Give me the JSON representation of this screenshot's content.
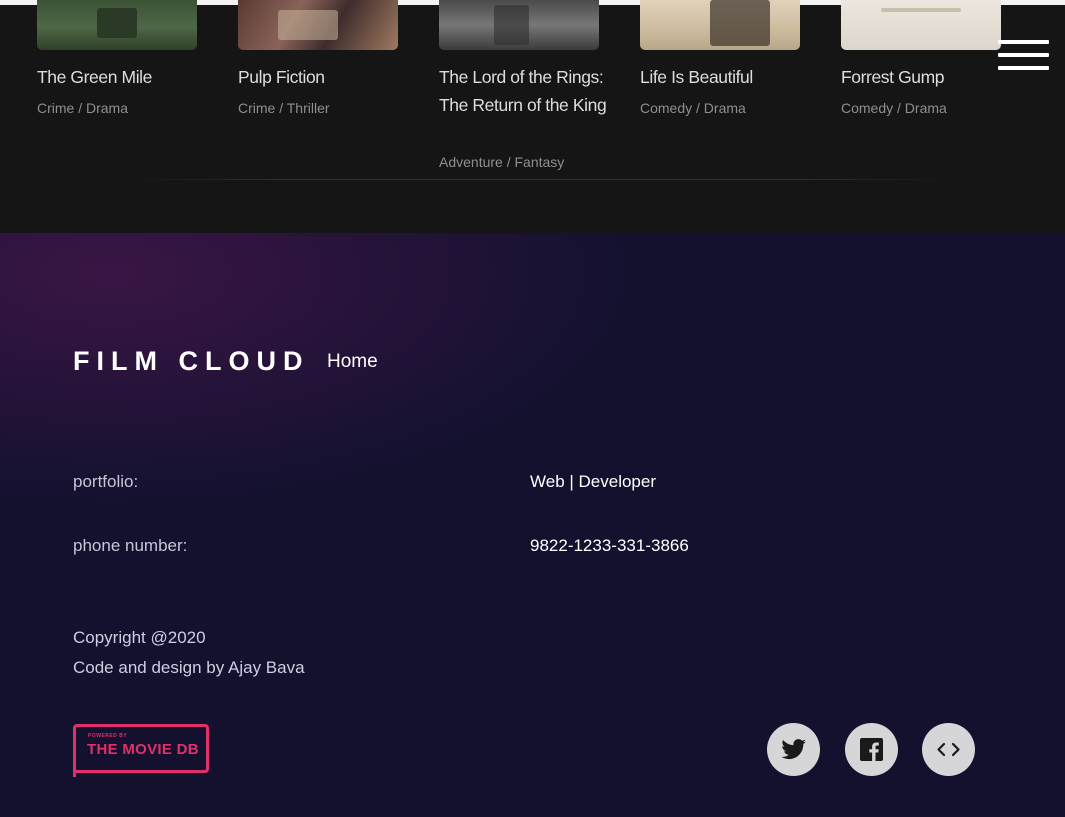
{
  "movies": [
    {
      "title": "The Green Mile",
      "genre": "Crime / Drama"
    },
    {
      "title": "Pulp Fiction",
      "genre": "Crime / Thriller"
    },
    {
      "title": "The Lord of the Rings: The Return of the King",
      "genre": "Adventure / Fantasy"
    },
    {
      "title": "Life Is Beautiful",
      "genre": "Comedy / Drama"
    },
    {
      "title": "Forrest Gump",
      "genre": "Comedy / Drama"
    }
  ],
  "nav": {
    "menu_icon": "hamburger-menu-icon"
  },
  "footer": {
    "brand": "FILM CLOUD",
    "home_link": "Home",
    "portfolio_label": "portfolio:",
    "portfolio_value": "Web | Developer",
    "phone_label": "phone number:",
    "phone_value": "9822-1233-331-3866",
    "copyright": "Copyright @2020",
    "credit": "Code and design by Ajay Bava",
    "tmdb_small": "POWERED BY",
    "tmdb_big": "THE MOVIE DB",
    "social_icons": [
      "twitter-icon",
      "facebook-icon",
      "code-icon"
    ]
  },
  "colors": {
    "strip_background": "#151515",
    "footer_background": "#14112f",
    "tmdb_accent": "#e0306a",
    "social_circle": "#d6d6d9",
    "social_glyph": "#1a1a1a"
  }
}
